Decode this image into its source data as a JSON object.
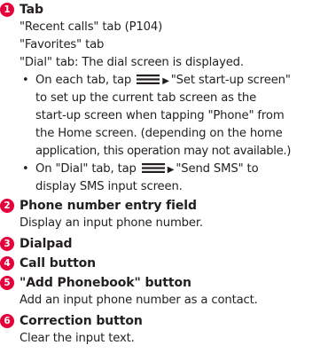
{
  "items": [
    {
      "number": "1",
      "title": "Tab",
      "lines": [
        "\"Recent calls\" tab (P104)",
        "\"Favorites\" tab",
        "\"Dial\" tab: The dial screen is displayed."
      ],
      "bullets": [
        {
          "lead": "On each tab, tap",
          "arrow": "▶",
          "first_rest": "\"Set start-up screen\"",
          "continuation": [
            "to set up the current tab screen as the",
            "start-up screen when tapping \"Phone\" from",
            "the Home screen. (depending on the home",
            "application, this operation may not available.)"
          ]
        },
        {
          "lead": "On \"Dial\" tab, tap",
          "arrow": "▶",
          "first_rest": "\"Send SMS\" to",
          "continuation": [
            "display SMS input screen."
          ]
        }
      ]
    },
    {
      "number": "2",
      "title": "Phone number entry field",
      "lines": [
        "Display an input phone number."
      ]
    },
    {
      "number": "3",
      "title": "Dialpad",
      "lines": []
    },
    {
      "number": "4",
      "title": "Call button",
      "lines": []
    },
    {
      "number": "5",
      "title": "\"Add Phonebook\" button",
      "lines": [
        "Add an input phone number as a contact."
      ]
    },
    {
      "number": "6",
      "title": "Correction button",
      "lines": [
        "Clear the input text."
      ]
    }
  ],
  "bullet_symbol": "•",
  "icons": {
    "menu": "menu-icon"
  },
  "colors": {
    "number_badge": "#e4003a",
    "text": "#231f20"
  }
}
